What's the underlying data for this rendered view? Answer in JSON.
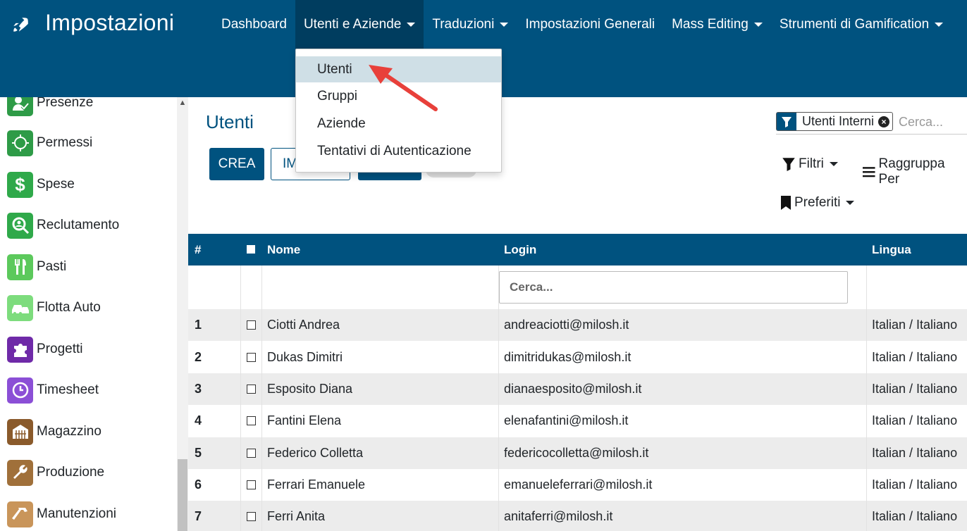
{
  "navbar": {
    "brand_icon": "rocket-icon",
    "title": "Impostazioni",
    "menu": [
      {
        "label": "Dashboard",
        "has_caret": false
      },
      {
        "label": "Utenti e Aziende",
        "has_caret": true,
        "active": true
      },
      {
        "label": "Traduzioni",
        "has_caret": true
      },
      {
        "label": "Impostazioni Generali",
        "has_caret": false
      },
      {
        "label": "Mass Editing",
        "has_caret": true
      },
      {
        "label": "Strumenti di Gamification",
        "has_caret": true
      }
    ]
  },
  "dropdown": {
    "items": [
      {
        "label": "Utenti",
        "highlighted": true
      },
      {
        "label": "Gruppi"
      },
      {
        "label": "Aziende"
      },
      {
        "label": "Tentativi di Autenticazione"
      }
    ]
  },
  "sidebar": {
    "items": [
      {
        "label": "Presenze",
        "icon": "presence-icon",
        "color": "#2e9b47"
      },
      {
        "label": "Permessi",
        "icon": "sun-icon",
        "color": "#2e9b47"
      },
      {
        "label": "Spese",
        "icon": "dollar-icon",
        "color": "#2fa94a"
      },
      {
        "label": "Reclutamento",
        "icon": "search-person-icon",
        "color": "#2fa94a"
      },
      {
        "label": "Pasti",
        "icon": "fork-knife-icon",
        "color": "#5cc95c"
      },
      {
        "label": "Flotta Auto",
        "icon": "car-icon",
        "color": "#7ddc7d"
      },
      {
        "label": "Progetti",
        "icon": "puzzle-icon",
        "color": "#6f2aa8"
      },
      {
        "label": "Timesheet",
        "icon": "clock-icon",
        "color": "#8b4fd6"
      },
      {
        "label": "Magazzino",
        "icon": "warehouse-icon",
        "color": "#8a5a2b"
      },
      {
        "label": "Produzione",
        "icon": "wrench-icon",
        "color": "#a0703a"
      },
      {
        "label": "Manutenzioni",
        "icon": "hammer-icon",
        "color": "#c9955a"
      }
    ]
  },
  "page": {
    "title": "Utenti",
    "buttons": {
      "create": "CREA",
      "import_partial": "IM"
    },
    "facet_label": "Utenti Interni",
    "search_placeholder": "Cerca...",
    "filters_label": "Filtri",
    "group_by_label": "Raggruppa Per",
    "favorites_label": "Preferiti"
  },
  "table": {
    "headers": {
      "num": "#",
      "name": "Nome",
      "login": "Login",
      "lang": "Lingua"
    },
    "filter_placeholder": "Cerca...",
    "rows": [
      {
        "num": "1",
        "name": "Ciotti Andrea",
        "login": "andreaciotti@milosh.it",
        "lang": "Italian / Italiano"
      },
      {
        "num": "2",
        "name": "Dukas Dimitri",
        "login": "dimitridukas@milosh.it",
        "lang": "Italian / Italiano"
      },
      {
        "num": "3",
        "name": "Esposito Diana",
        "login": "dianaesposito@milosh.it",
        "lang": "Italian / Italiano"
      },
      {
        "num": "4",
        "name": "Fantini Elena",
        "login": "elenafantini@milosh.it",
        "lang": "Italian / Italiano"
      },
      {
        "num": "5",
        "name": "Federico Colletta",
        "login": "federicocolletta@milosh.it",
        "lang": "Italian / Italiano"
      },
      {
        "num": "6",
        "name": "Ferrari Emanuele",
        "login": "emanueleferrari@milosh.it",
        "lang": "Italian / Italiano"
      },
      {
        "num": "7",
        "name": "Ferri Anita",
        "login": "anitaferri@milosh.it",
        "lang": "Italian / Italiano"
      }
    ]
  },
  "colors": {
    "primary": "#00527f",
    "active_menu": "#003d5f",
    "highlight": "#cfdfe6",
    "arrow": "#e8403a"
  }
}
